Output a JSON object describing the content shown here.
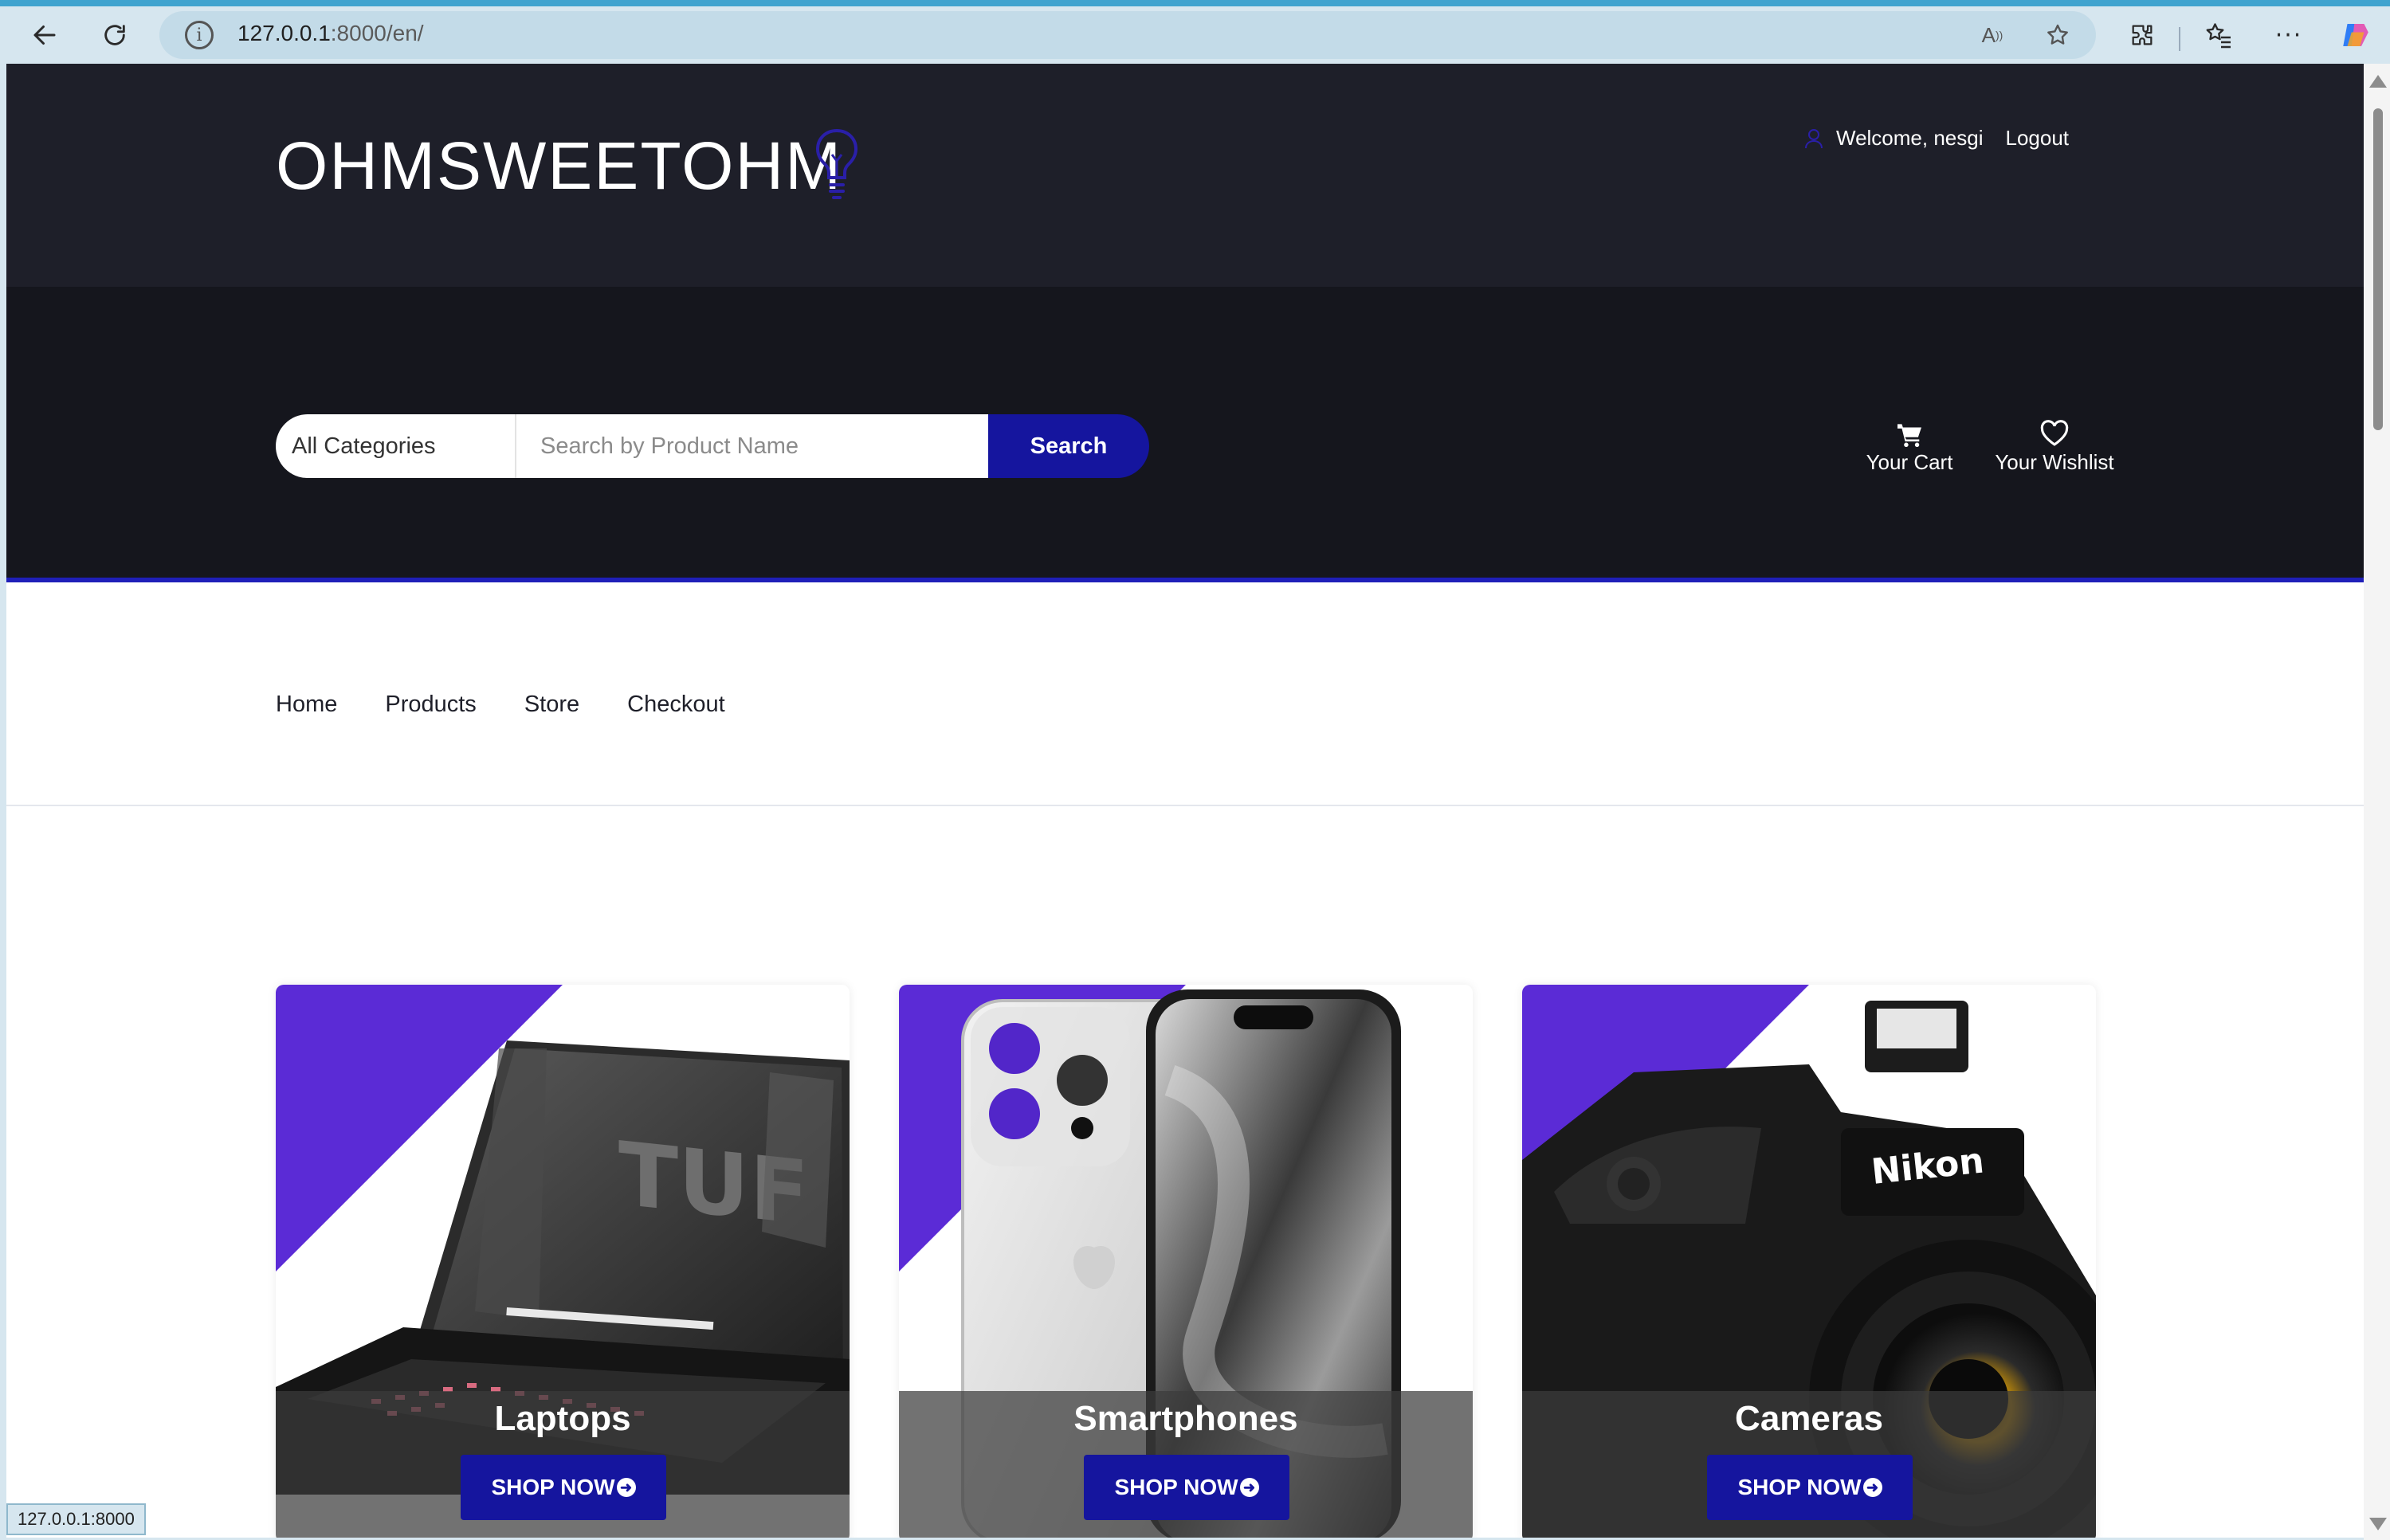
{
  "browser": {
    "url_host": "127.0.0.1",
    "url_rest": ":8000/en/",
    "status_url": "127.0.0.1:8000"
  },
  "header": {
    "logo": "OHMSWEETOHM",
    "welcome": "Welcome, nesgi",
    "logout": "Logout"
  },
  "search": {
    "category": "All Categories",
    "placeholder": "Search by Product Name",
    "button": "Search"
  },
  "actions": {
    "cart": "Your Cart",
    "wishlist": "Your Wishlist"
  },
  "nav": [
    "Home",
    "Products",
    "Store",
    "Checkout"
  ],
  "cards": [
    {
      "title": "Laptops",
      "cta": "SHOP NOW"
    },
    {
      "title": "Smartphones",
      "cta": "SHOP NOW"
    },
    {
      "title": "Cameras",
      "cta": "SHOP NOW"
    }
  ],
  "colors": {
    "accent": "#15159e",
    "triangle": "#5b2bd6",
    "header_top": "#1e1f29",
    "header_main": "#15161d"
  }
}
